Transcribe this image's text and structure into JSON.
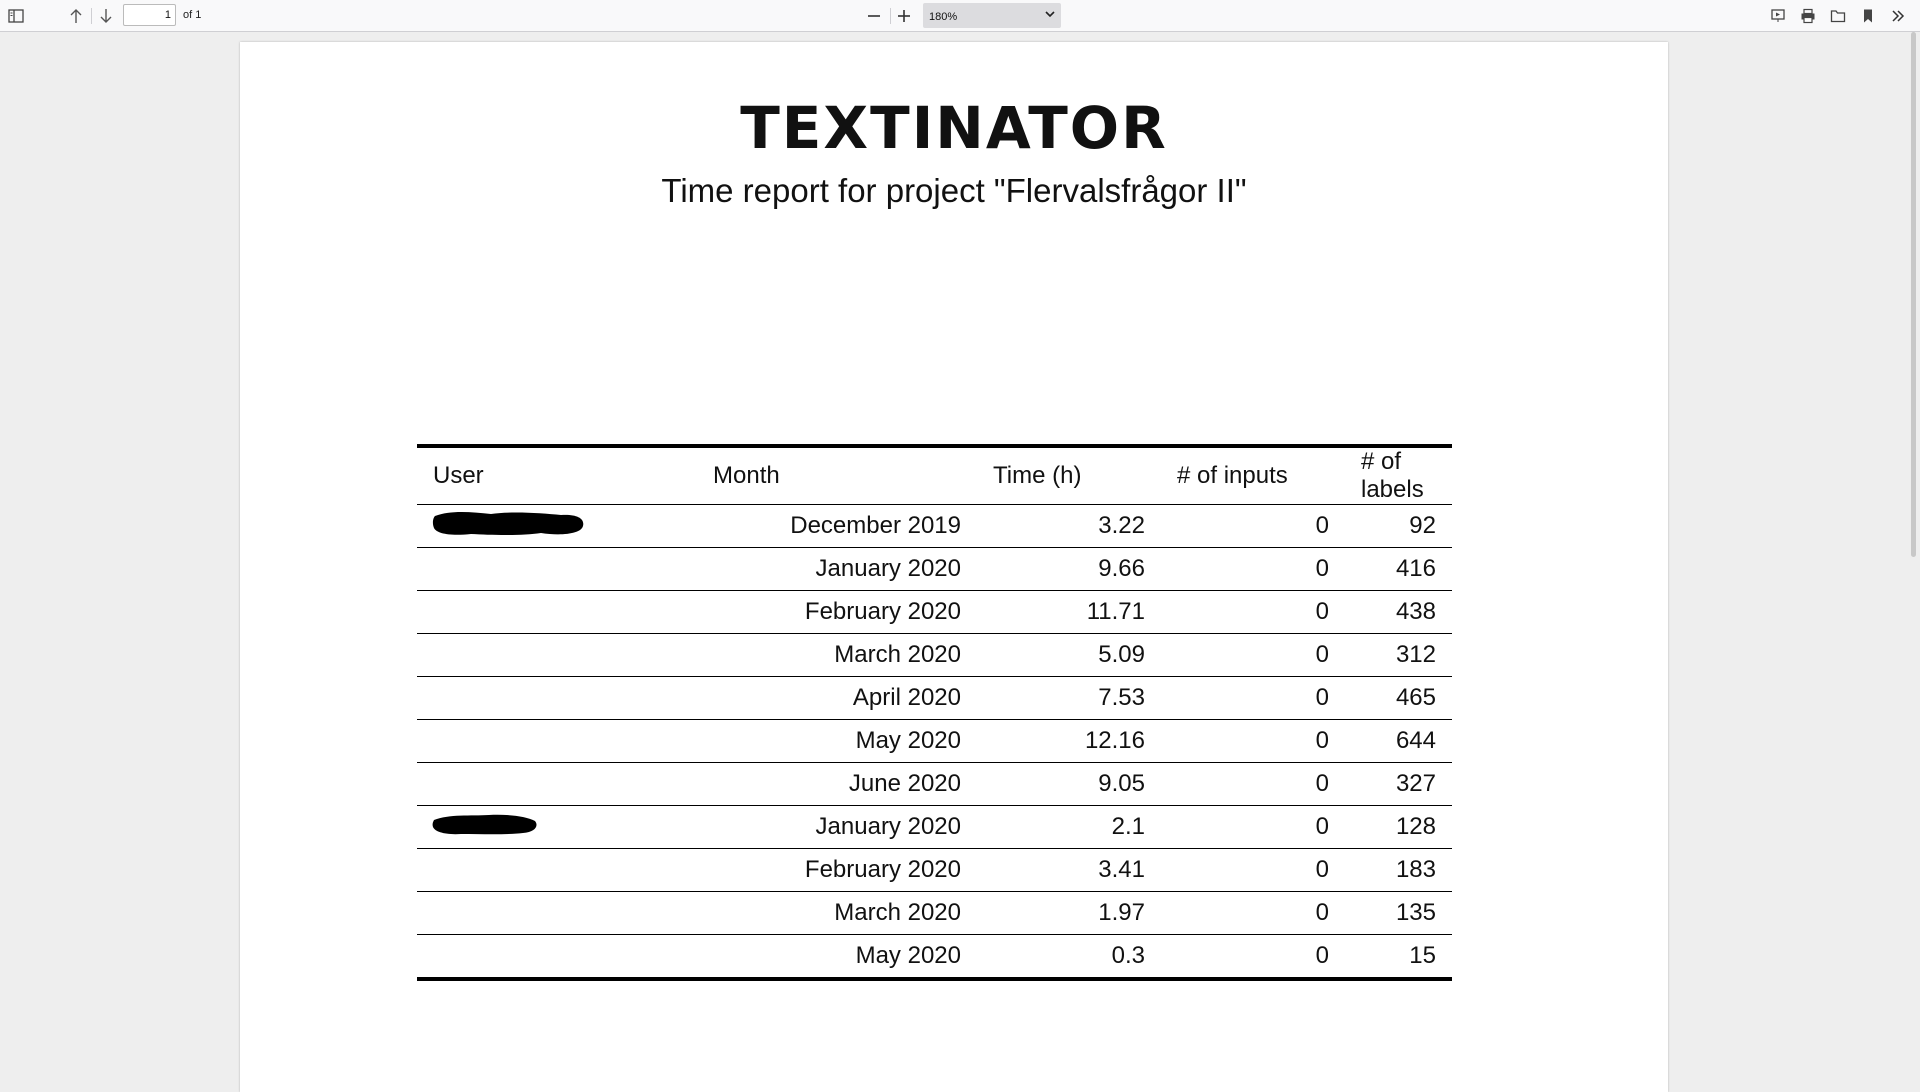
{
  "toolbar": {
    "page_number": "1",
    "page_of": "of 1",
    "zoom": "180%"
  },
  "document": {
    "logo_text": "TEXTINATOR",
    "title": "Time report for project \"Flervalsfrågor II\""
  },
  "table": {
    "headers": [
      "User",
      "Month",
      "Time (h)",
      "# of inputs",
      "# of labels"
    ],
    "rows": [
      {
        "user_redacted": true,
        "month": "December 2019",
        "time": "3.22",
        "inputs": "0",
        "labels": "92"
      },
      {
        "user_redacted": false,
        "month": "January 2020",
        "time": "9.66",
        "inputs": "0",
        "labels": "416"
      },
      {
        "user_redacted": false,
        "month": "February 2020",
        "time": "11.71",
        "inputs": "0",
        "labels": "438"
      },
      {
        "user_redacted": false,
        "month": "March 2020",
        "time": "5.09",
        "inputs": "0",
        "labels": "312"
      },
      {
        "user_redacted": false,
        "month": "April 2020",
        "time": "7.53",
        "inputs": "0",
        "labels": "465"
      },
      {
        "user_redacted": false,
        "month": "May 2020",
        "time": "12.16",
        "inputs": "0",
        "labels": "644"
      },
      {
        "user_redacted": false,
        "month": "June 2020",
        "time": "9.05",
        "inputs": "0",
        "labels": "327"
      },
      {
        "user_redacted": true,
        "month": "January 2020",
        "time": "2.1",
        "inputs": "0",
        "labels": "128"
      },
      {
        "user_redacted": false,
        "month": "February 2020",
        "time": "3.41",
        "inputs": "0",
        "labels": "183"
      },
      {
        "user_redacted": false,
        "month": "March 2020",
        "time": "1.97",
        "inputs": "0",
        "labels": "135"
      },
      {
        "user_redacted": false,
        "month": "May 2020",
        "time": "0.3",
        "inputs": "0",
        "labels": "15"
      }
    ]
  }
}
